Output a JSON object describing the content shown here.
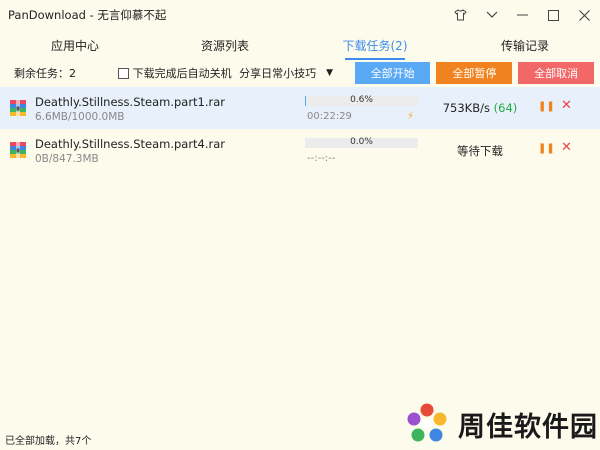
{
  "window": {
    "title": "PanDownload - 无言仰慕不起"
  },
  "tabs": [
    {
      "label": "应用中心"
    },
    {
      "label": "资源列表"
    },
    {
      "label": "下载任务(2)"
    },
    {
      "label": "传输记录"
    }
  ],
  "toolbar": {
    "remaining": "剩余任务：2",
    "shutdown_label": "下载完成后自动关机",
    "shutdown_checked": false,
    "tips_label": "分享日常小技巧",
    "start_all": "全部开始",
    "pause_all": "全部暂停",
    "cancel_all": "全部取消"
  },
  "downloads": [
    {
      "name": "Deathly.Stillness.Steam.part1.rar",
      "size": "6.6MB/1000.0MB",
      "progress_text": "0.6%",
      "progress": 0.006,
      "eta": "00:22:29",
      "speed": "753KB/s",
      "connections": "(64)",
      "status": ""
    },
    {
      "name": "Deathly.Stillness.Steam.part4.rar",
      "size": "0B/847.3MB",
      "progress_text": "0.0%",
      "progress": 0.0,
      "eta": "--:--:--",
      "speed": "",
      "connections": "",
      "status": "等待下载"
    }
  ],
  "status_bar": {
    "text": "已全部加载，共7个"
  },
  "watermark": {
    "text": "周佳软件园"
  },
  "colors": {
    "accent": "#3b8ef0",
    "start_button": "#5aa9f5",
    "pause_button": "#f0821f",
    "cancel_button": "#f26868",
    "progress_fill": "#57a8ee",
    "connections_green": "#22aa44",
    "background": "#fdfbec"
  },
  "icons": {
    "titlebar": [
      "shirt-icon",
      "chevron-down-icon",
      "minimize-icon",
      "maximize-icon",
      "close-icon"
    ],
    "row": [
      "rar-archive-icon",
      "lightning-icon",
      "pause-icon",
      "cancel-icon"
    ]
  }
}
